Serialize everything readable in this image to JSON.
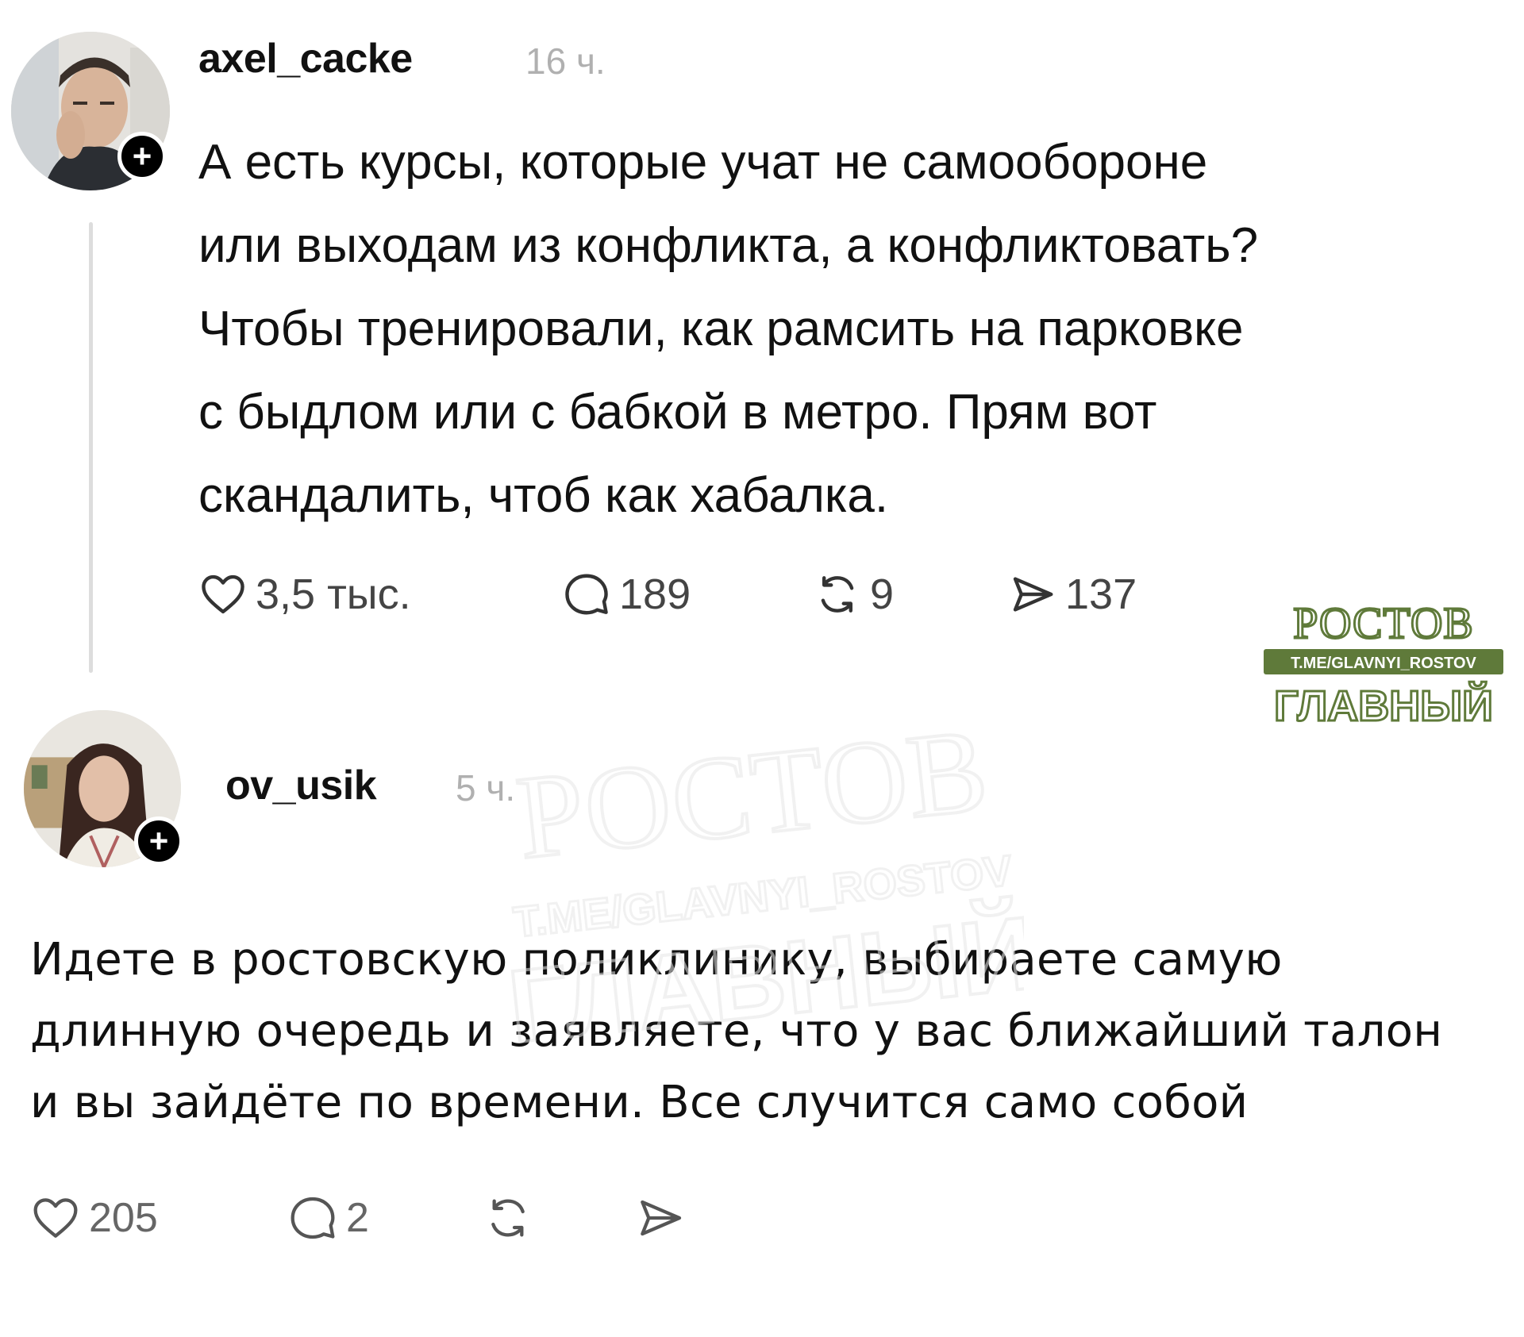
{
  "post1": {
    "username": "axel_cacke",
    "time": "16 ч.",
    "text": "А есть курсы, которые учат не самообороне\nили выходам из конфликта, а конфликтовать?\nЧтобы тренировали, как рамсить на парковке\nс быдлом или с бабкой в метро. Прям вот\nскандалить, чтоб как хабалка.",
    "likes": "3,5 тыс.",
    "comments": "189",
    "reposts": "9",
    "shares": "137"
  },
  "post2": {
    "username": "ov_usik",
    "time": "5 ч.",
    "text": "Идете в ростовскую поликлинику, выбираете самую\nдлинную очередь и заявляете, что у вас ближайший талон\nи вы зайдёте по времени. Все случится само собой",
    "likes": "205",
    "comments": "2"
  },
  "follow_symbol": "+",
  "watermark": {
    "line1": "РОСТОВ",
    "line2": "T.ME/GLAVNYI_ROSTOV",
    "line3": "ГЛАВНЫЙ",
    "color": "#5f7a3a"
  },
  "colors": {
    "text": "#111111",
    "muted": "#b0b0b0",
    "thread_line": "#dddddd"
  },
  "icons": [
    "heart-icon",
    "comment-icon",
    "repost-icon",
    "share-icon",
    "plus-icon"
  ]
}
